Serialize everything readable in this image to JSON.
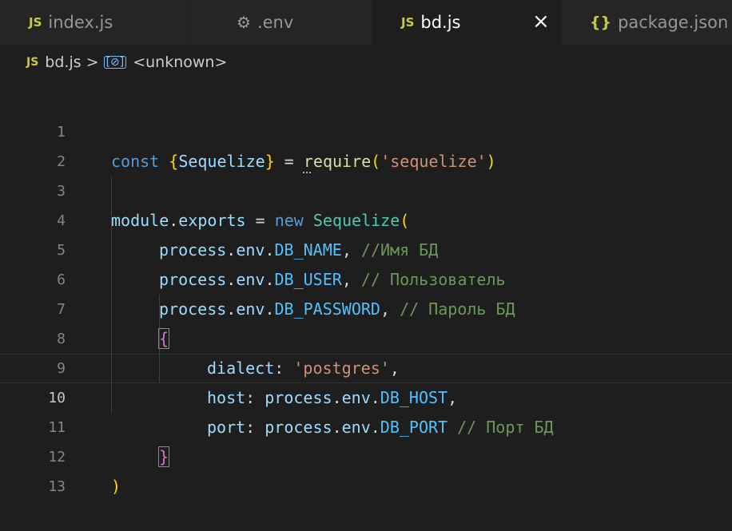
{
  "tabs": [
    {
      "icon_text": "JS",
      "label": "index.js",
      "active": false
    },
    {
      "icon_text": "⚙",
      "label": ".env",
      "active": false
    },
    {
      "icon_text": "JS",
      "label": "bd.js",
      "active": true,
      "close_label": "×"
    },
    {
      "icon_text": "{}",
      "label": "package.json",
      "active": false
    }
  ],
  "breadcrumb": {
    "file_icon_text": "JS",
    "file": "bd.js",
    "separator": ">",
    "symbol_icon_text": "[⊘]",
    "symbol": "<unknown>"
  },
  "editor": {
    "line_numbers": [
      "1",
      "2",
      "3",
      "4",
      "5",
      "6",
      "7",
      "8",
      "9",
      "10",
      "11",
      "12",
      "13"
    ],
    "current_line": "10",
    "lines": {
      "l1": {
        "kw": "const",
        "b_open": "{",
        "name": "Sequelize",
        "b_close": "}",
        "eq": " = ",
        "req_r": "r",
        "req_rest": "equire",
        "p_open": "(",
        "str": "'sequelize'",
        "p_close": ")"
      },
      "l3": {
        "mod": "module",
        "dot": ".",
        "exports": "exports",
        "eq": " = ",
        "kw": "new",
        "cls": "Sequelize",
        "p_open": "("
      },
      "l4": {
        "obj": "process",
        "dot1": ".",
        "env": "env",
        "dot2": ".",
        "const": "DB_NAME",
        "comma": ", ",
        "cmt": "//Имя БД"
      },
      "l5": {
        "obj": "process",
        "dot1": ".",
        "env": "env",
        "dot2": ".",
        "const": "DB_USER",
        "comma": ", ",
        "cmt": "// Пользователь"
      },
      "l6": {
        "obj": "process",
        "dot1": ".",
        "env": "env",
        "dot2": ".",
        "const": "DB_PASSWORD",
        "comma": ", ",
        "cmt": "// Пароль БД"
      },
      "l7": {
        "brace": "{"
      },
      "l8": {
        "key": "dialect",
        "colon": ": ",
        "str": "'postgres'",
        "comma": ","
      },
      "l9": {
        "key": "host",
        "colon": ": ",
        "obj": "process",
        "dot1": ".",
        "env": "env",
        "dot2": ".",
        "const": "DB_HOST",
        "comma": ","
      },
      "l10": {
        "key": "port",
        "colon": ": ",
        "obj": "process",
        "dot1": ".",
        "env": "env",
        "dot2": ".",
        "const": "DB_PORT",
        "sp": " ",
        "cmt": "// Порт БД"
      },
      "l11": {
        "brace": "}"
      },
      "l12": {
        "paren": ")"
      }
    }
  }
}
